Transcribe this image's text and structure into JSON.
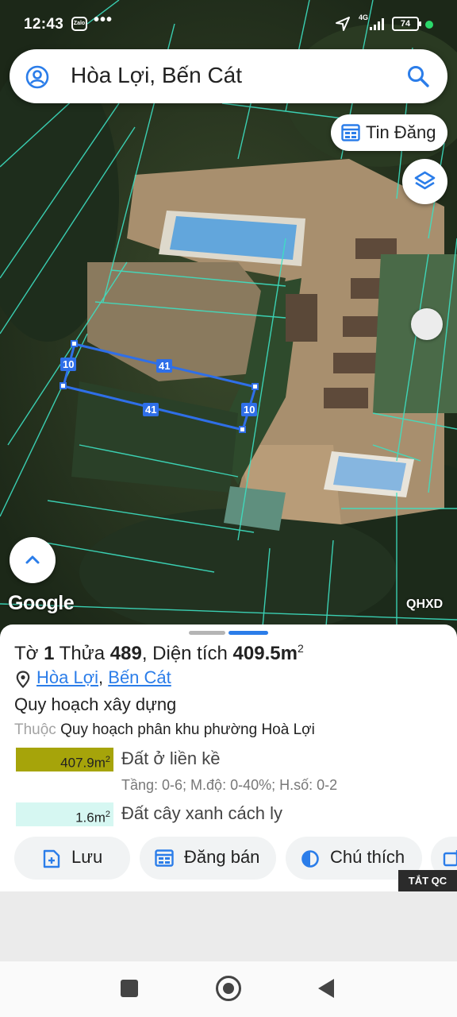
{
  "status_bar": {
    "time": "12:43",
    "app_badge": "Zalo",
    "more": "•••",
    "network": "4G",
    "battery": "74",
    "dot_color": "#2bd96b"
  },
  "search": {
    "query": "Hòa Lợi, Bến Cát"
  },
  "map": {
    "tin_dang_label": "Tin Đăng",
    "google_logo": "Google",
    "layer_badge": "QHXD",
    "dimensions": {
      "left_side": "10",
      "top_side": "41",
      "bottom_side": "41",
      "right_side": "10"
    },
    "parcel_color": "#2f6fe8",
    "gridline_color": "#3de0c2"
  },
  "parcel": {
    "sheet_prefix": "Tờ",
    "sheet_number": "1",
    "lot_prefix": "Thửa",
    "lot_number": "489",
    "area_prefix": ", Diện tích",
    "area_value": "409.5m",
    "area_unit_exp": "2",
    "ward": "Hòa Lợi",
    "district": "Bến Cát"
  },
  "zoning": {
    "heading": "Quy hoạch xây dựng",
    "belongs_prefix": "Thuộc",
    "plan_name": "Quy hoạch phân khu phường Hoà Lợi",
    "zones": [
      {
        "area": "407.9m",
        "area_exp": "2",
        "name": "Đất ở liền kề",
        "detail": "Tầng: 0-6; M.độ: 0-40%; H.số: 0-2",
        "color": "#a6a40a"
      },
      {
        "area": "1.6m",
        "area_exp": "2",
        "name": "Đất cây xanh cách ly",
        "color": "#d6f7f2"
      }
    ]
  },
  "actions": {
    "save": "Lưu",
    "post_sale": "Đăng bán",
    "legend": "Chú thích"
  },
  "ad": {
    "close_label": "TẮT QC"
  },
  "colors": {
    "accent": "#2b7de9"
  }
}
